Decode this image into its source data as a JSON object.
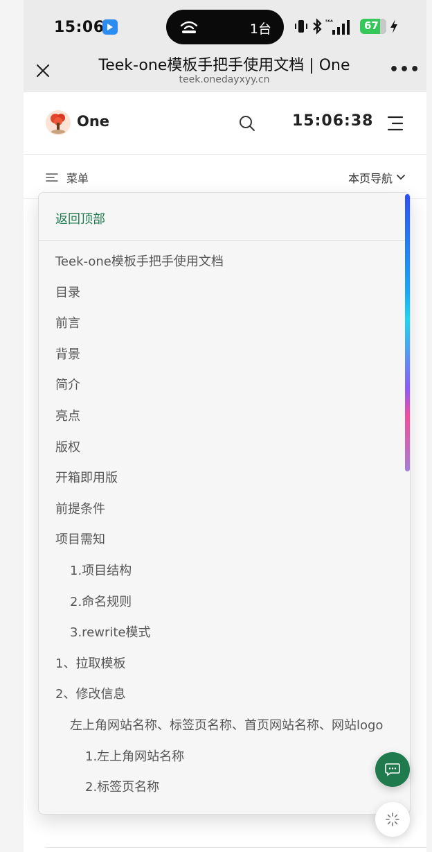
{
  "status_bar": {
    "time": "15:06",
    "island_text": "1台",
    "battery": "67"
  },
  "browser": {
    "page_title": "Teek-one模板手把手使用文档 | One",
    "url": "teek.onedayxyy.cn",
    "more_label": "•••"
  },
  "site_header": {
    "site_name": "One",
    "clock": "15:06:38"
  },
  "local_nav": {
    "menu_label": "菜单",
    "outline_label": "本页导航"
  },
  "outline": {
    "back_to_top": "返回顶部",
    "items": [
      {
        "label": "Teek-one模板手把手使用文档",
        "level": 1
      },
      {
        "label": "目录",
        "level": 1
      },
      {
        "label": "前言",
        "level": 1
      },
      {
        "label": "背景",
        "level": 1
      },
      {
        "label": "简介",
        "level": 1
      },
      {
        "label": "亮点",
        "level": 1
      },
      {
        "label": "版权",
        "level": 1
      },
      {
        "label": "开箱即用版",
        "level": 1
      },
      {
        "label": "前提条件",
        "level": 1
      },
      {
        "label": "项目需知",
        "level": 1
      },
      {
        "label": "1.项目结构",
        "level": 2
      },
      {
        "label": "2.命名规则",
        "level": 2
      },
      {
        "label": "3.rewrite模式",
        "level": 2
      },
      {
        "label": "1、拉取模板",
        "level": 1
      },
      {
        "label": "2、修改信息",
        "level": 1
      },
      {
        "label": "左上角网站名称、标签页名称、首页网站名称、网站logo",
        "level": 2
      },
      {
        "label": "1.左上角网站名称",
        "level": 3
      },
      {
        "label": "2.标签页名称",
        "level": 3
      }
    ]
  },
  "colors": {
    "accent": "#1f7a4d",
    "status_bar_bg": "#ebebeb",
    "panel_bg": "#f6f6f7"
  },
  "icons": {
    "close": "close-icon",
    "more": "more-icon",
    "search": "search-icon",
    "menu": "hamburger-icon",
    "chat": "chat-icon",
    "loading": "loading-icon"
  }
}
